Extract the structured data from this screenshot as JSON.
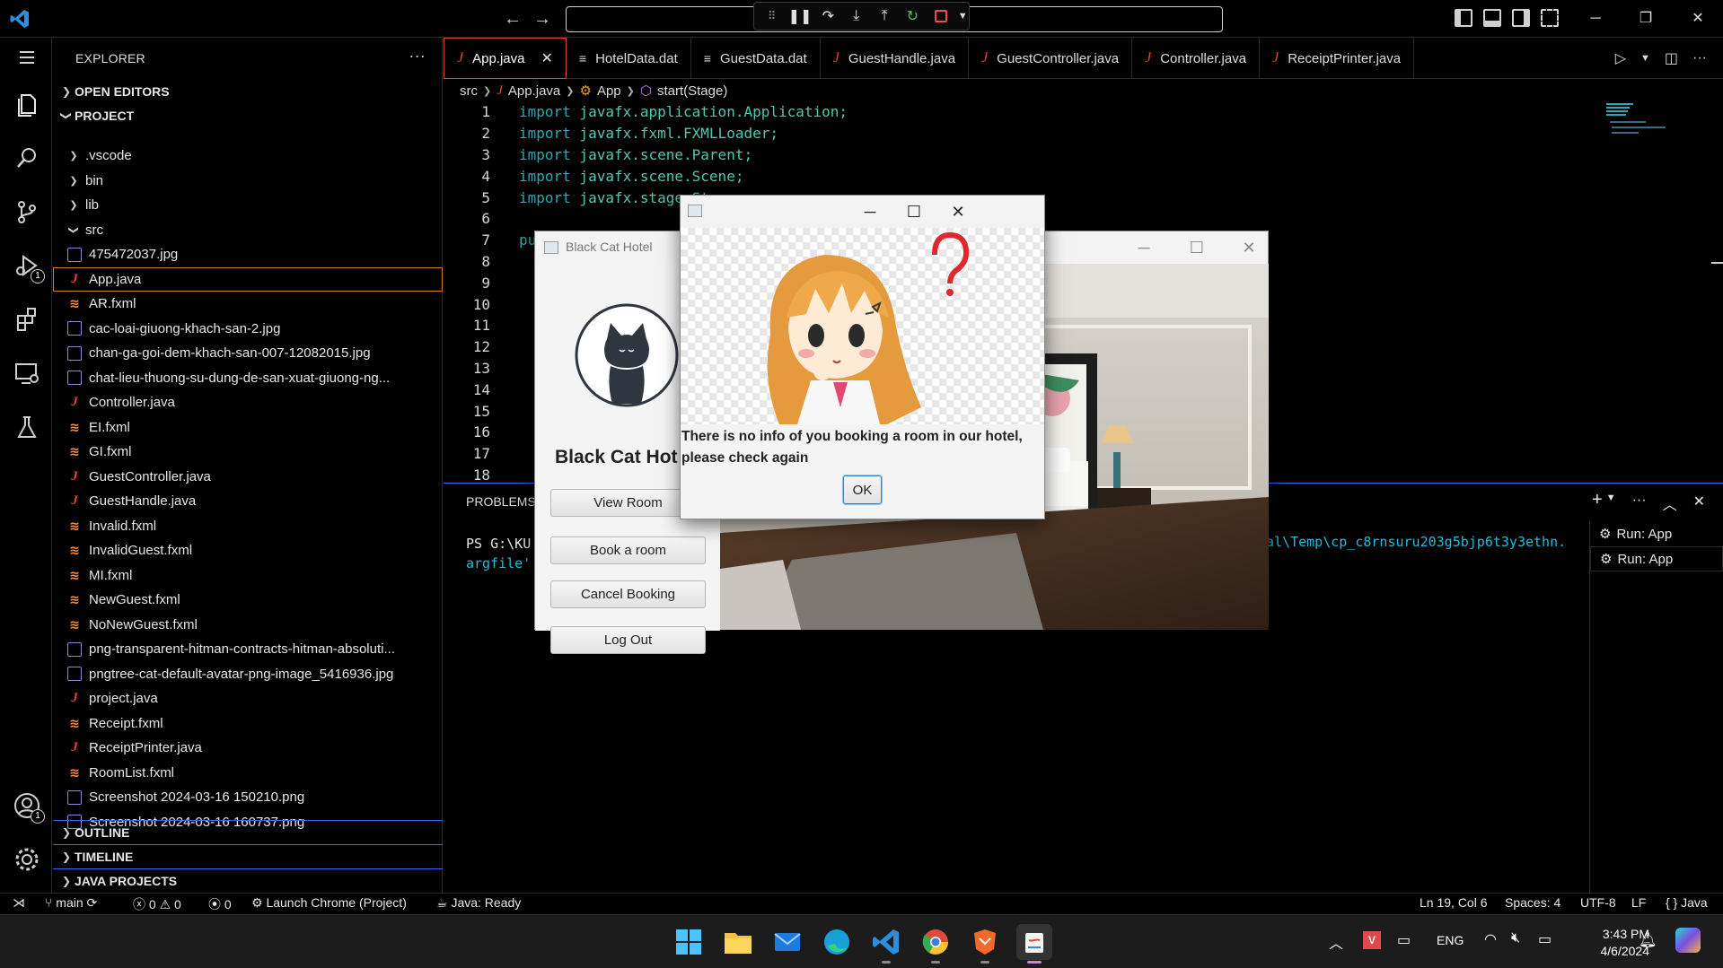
{
  "vscode": {
    "sidebar": {
      "title": "EXPLORER",
      "sections": {
        "open_editors": "OPEN EDITORS",
        "project": "PROJECT",
        "outline": "OUTLINE",
        "timeline": "TIMELINE",
        "java_projects": "JAVA PROJECTS"
      },
      "folders": [
        ".vscode",
        "bin",
        "lib",
        "src"
      ],
      "files": [
        {
          "name": "475472037.jpg",
          "type": "img"
        },
        {
          "name": "App.java",
          "type": "java"
        },
        {
          "name": "AR.fxml",
          "type": "xml"
        },
        {
          "name": "cac-loai-giuong-khach-san-2.jpg",
          "type": "img"
        },
        {
          "name": "chan-ga-goi-dem-khach-san-007-12082015.jpg",
          "type": "img"
        },
        {
          "name": "chat-lieu-thuong-su-dung-de-san-xuat-giuong-ng...",
          "type": "img"
        },
        {
          "name": "Controller.java",
          "type": "java"
        },
        {
          "name": "EI.fxml",
          "type": "xml"
        },
        {
          "name": "GI.fxml",
          "type": "xml"
        },
        {
          "name": "GuestController.java",
          "type": "java"
        },
        {
          "name": "GuestHandle.java",
          "type": "java"
        },
        {
          "name": "Invalid.fxml",
          "type": "xml"
        },
        {
          "name": "InvalidGuest.fxml",
          "type": "xml"
        },
        {
          "name": "MI.fxml",
          "type": "xml"
        },
        {
          "name": "NewGuest.fxml",
          "type": "xml"
        },
        {
          "name": "NoNewGuest.fxml",
          "type": "xml"
        },
        {
          "name": "png-transparent-hitman-contracts-hitman-absoluti...",
          "type": "img"
        },
        {
          "name": "pngtree-cat-default-avatar-png-image_5416936.jpg",
          "type": "img"
        },
        {
          "name": "project.java",
          "type": "java"
        },
        {
          "name": "Receipt.fxml",
          "type": "xml"
        },
        {
          "name": "ReceiptPrinter.java",
          "type": "java"
        },
        {
          "name": "RoomList.fxml",
          "type": "xml"
        },
        {
          "name": "Screenshot 2024-03-16 150210.png",
          "type": "img"
        },
        {
          "name": "Screenshot 2024-03-16 160737.png",
          "type": "img"
        }
      ]
    },
    "tabs": [
      {
        "label": "App.java",
        "icon": "java"
      },
      {
        "label": "HotelData.dat",
        "icon": "lines"
      },
      {
        "label": "GuestData.dat",
        "icon": "lines"
      },
      {
        "label": "GuestHandle.java",
        "icon": "java"
      },
      {
        "label": "GuestController.java",
        "icon": "java"
      },
      {
        "label": "Controller.java",
        "icon": "java"
      },
      {
        "label": "ReceiptPrinter.java",
        "icon": "java"
      }
    ],
    "breadcrumb": [
      "src",
      "App.java",
      "App",
      "start(Stage)"
    ],
    "code": [
      {
        "n": "1",
        "kw": "import",
        "rest": " javafx.application.Application;"
      },
      {
        "n": "2",
        "kw": "import",
        "rest": " javafx.fxml.FXMLLoader;"
      },
      {
        "n": "3",
        "kw": "import",
        "rest": " javafx.scene.Parent;"
      },
      {
        "n": "4",
        "kw": "import",
        "rest": " javafx.scene.Scene;"
      },
      {
        "n": "5",
        "kw": "import",
        "rest": " javafx.stage.St"
      },
      {
        "n": "6",
        "kw": "",
        "rest": ""
      },
      {
        "n": "7",
        "kw": "pu",
        "rest": ""
      },
      {
        "n": "8",
        "kw": "",
        "rest": ""
      },
      {
        "n": "9",
        "kw": "",
        "rest": ""
      },
      {
        "n": "10",
        "kw": "",
        "rest": ""
      },
      {
        "n": "11",
        "kw": "",
        "rest": ""
      },
      {
        "n": "12",
        "kw": "",
        "rest": ""
      },
      {
        "n": "13",
        "kw": "",
        "rest": ""
      },
      {
        "n": "14",
        "kw": "",
        "rest": ""
      },
      {
        "n": "15",
        "kw": "",
        "rest": ""
      },
      {
        "n": "16",
        "kw": "",
        "rest": ""
      },
      {
        "n": "17",
        "kw": "",
        "rest": ""
      },
      {
        "n": "18",
        "kw": "",
        "rest": ""
      }
    ],
    "panel": {
      "tab": "PROBLEMS",
      "term_line1": "PS G:\\KU",
      "term_line2": "argfile'",
      "term_right": "al\\Temp\\cp_c8rnsuru203g5bjp6t3y3ethn.",
      "terminals": [
        "Run: App",
        "Run: App"
      ]
    },
    "status": {
      "branch": "main",
      "errors": "0",
      "warnings": "0",
      "ports": "0",
      "launch": "Launch Chrome (Project)",
      "java": "Java: Ready",
      "position": "Ln 19, Col 6",
      "spaces": "Spaces: 4",
      "encoding": "UTF-8",
      "eol": "LF",
      "language": "{ } Java"
    }
  },
  "hotel_window": {
    "title": "Black Cat Hotel",
    "brand": "Black Cat Hot",
    "buttons": [
      "View Room",
      "Book a room",
      "Cancel Booking",
      "Log Out"
    ]
  },
  "alert": {
    "message": "There is no info of you booking a room in our hotel, please check again",
    "ok": "OK"
  },
  "taskbar": {
    "lang": "ENG",
    "time": "3:43 PM",
    "date": "4/6/2024"
  }
}
